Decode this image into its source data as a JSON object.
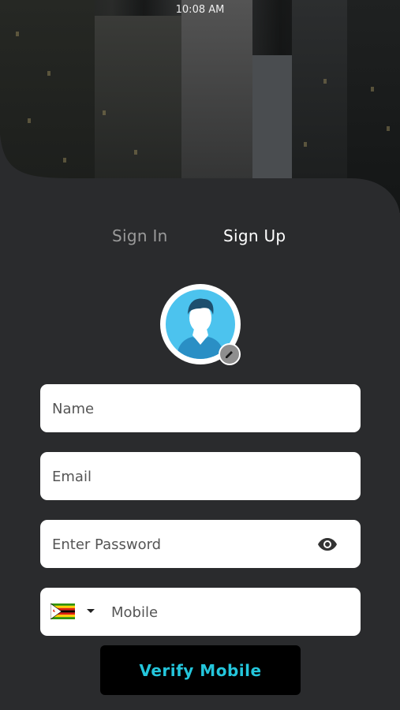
{
  "status_bar": {
    "time": "10:08 AM"
  },
  "tabs": [
    {
      "label": "Sign In",
      "active": false
    },
    {
      "label": "Sign Up",
      "active": true
    }
  ],
  "avatar": {
    "icon": "user-avatar-icon",
    "edit_icon": "pencil-icon"
  },
  "form": {
    "name_placeholder": "Name",
    "email_placeholder": "Email",
    "password_placeholder": "Enter Password",
    "mobile_placeholder": "Mobile",
    "country_flag": "zimbabwe-flag-icon"
  },
  "verify_button": {
    "label": "Verify Mobile"
  },
  "colors": {
    "background": "#2a2b2d",
    "accent": "#24c6dc",
    "avatar_bg": "#4cc3ee",
    "inactive_tab": "#9a9a9a"
  }
}
